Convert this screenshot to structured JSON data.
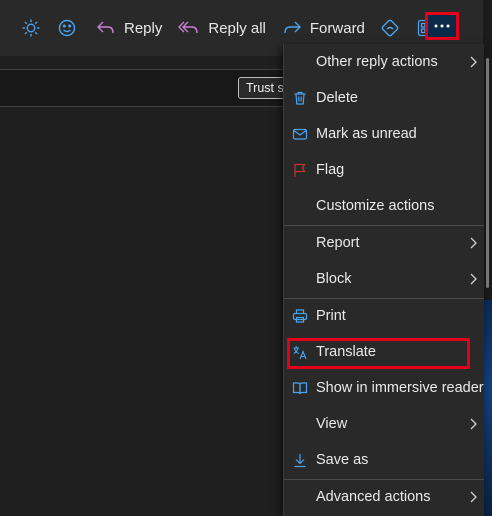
{
  "toolbar": {
    "reply_label": "Reply",
    "reply_all_label": "Reply all",
    "forward_label": "Forward",
    "icons": [
      "sun-icon",
      "emoji-icon",
      "reply-icon",
      "reply-all-icon",
      "forward-icon",
      "sticker-icon",
      "apps-icon",
      "more-icon"
    ]
  },
  "content": {
    "trust_button": "Trust se"
  },
  "menu": {
    "items": [
      {
        "label": "Other reply actions",
        "submenu": true
      },
      {
        "label": "Delete",
        "icon": "trash-icon"
      },
      {
        "label": "Mark as unread",
        "icon": "envelope-icon"
      },
      {
        "label": "Flag",
        "icon": "flag-icon"
      },
      {
        "label": "Customize actions"
      },
      {
        "label": "Report",
        "submenu": true
      },
      {
        "label": "Block",
        "submenu": true
      },
      {
        "label": "Print",
        "icon": "printer-icon"
      },
      {
        "label": "Translate",
        "icon": "translate-icon",
        "highlighted": true
      },
      {
        "label": "Show in immersive reader",
        "icon": "immersive-reader-icon"
      },
      {
        "label": "View",
        "submenu": true
      },
      {
        "label": "Save as",
        "icon": "download-icon"
      },
      {
        "label": "Advanced actions",
        "submenu": true
      }
    ]
  },
  "colors": {
    "accent": "#4aa3f0",
    "highlight_border": "#e3001b",
    "menu_bg": "#292929",
    "page_bg": "#1f1f1f",
    "reply_icon": "#c77fd6",
    "flag_icon": "#c0392b"
  }
}
